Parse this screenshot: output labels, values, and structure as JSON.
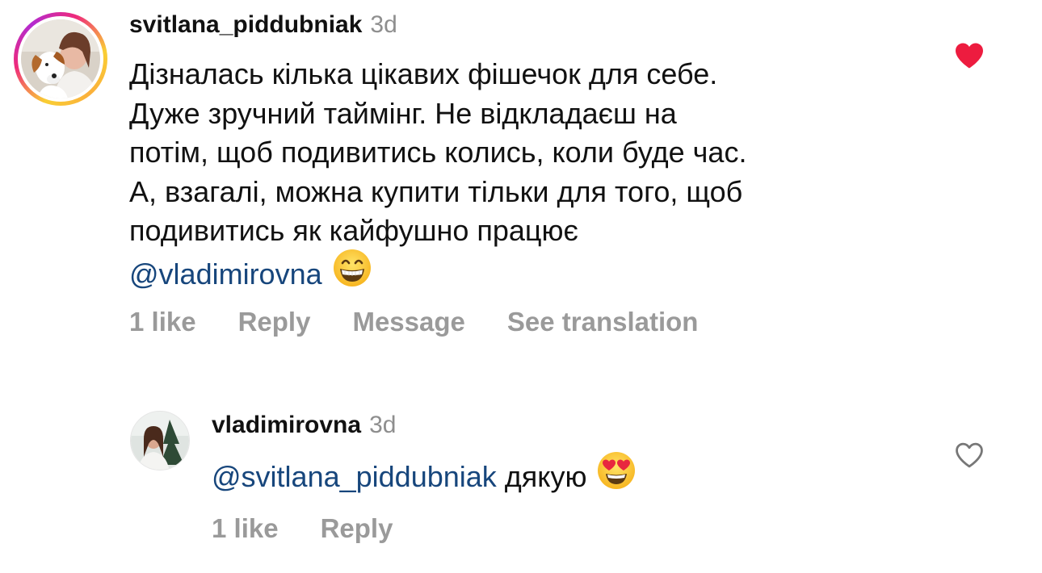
{
  "comments": [
    {
      "username": "svitlana_piddubniak",
      "time": "3d",
      "lines": [
        "Дізналась кілька цікавих фішечок для себе.",
        "Дуже зручний таймінг. Не відкладаєш на",
        "потім, щоб подивитись колись, коли буде час.",
        "А, взагалі, можна купити тільки для того, щоб",
        "подивитись як кайфушно працює"
      ],
      "mention": "@vladimirovna",
      "emoji": "grinning-face-with-smiling-eyes",
      "liked": true,
      "actions": {
        "likes": "1 like",
        "reply": "Reply",
        "message": "Message",
        "translate": "See translation"
      }
    },
    {
      "username": "vladimirovna",
      "time": "3d",
      "mention": "@svitlana_piddubniak",
      "text": "дякую",
      "emoji": "smiling-face-with-heart-eyes",
      "liked": false,
      "actions": {
        "likes": "1 like",
        "reply": "Reply"
      }
    }
  ],
  "colors": {
    "mention": "#17467c",
    "liked_heart": "#ed1c3f",
    "muted": "#8e8e8e"
  }
}
